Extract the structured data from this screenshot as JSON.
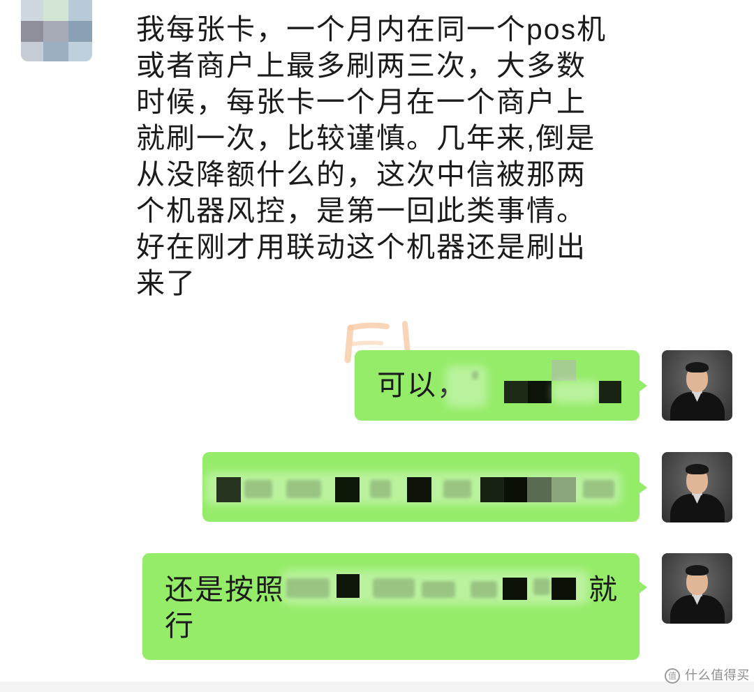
{
  "chat": {
    "incoming": {
      "lines": [
        "我每张卡，一个月内在同一个pos机",
        "或者商户上最多刷两三次，大多数",
        "时候，每张卡一个月在一个商户上",
        "就刷一次，比较谨慎。几年来,倒是",
        "从没降额什么的，这次中信被那两",
        "个机器风控，是第一回此类事情。",
        "好在刚才用联动这个机器还是刷出",
        "来了"
      ]
    },
    "outgoing": [
      {
        "text_start": "可以，"
      },
      {},
      {
        "line1_start": "还是按照",
        "line1_end": "就",
        "line2": "行"
      }
    ]
  },
  "watermark": {
    "logo_text": "值",
    "text": "什么值得买"
  },
  "icons": {
    "contact_avatar": "contact-avatar",
    "sender_avatar": "user-avatar",
    "watermark_logo": "zhide-logo-icon"
  },
  "colors": {
    "outgoing_bubble": "#95ec69",
    "message_text": "#1b1b1b",
    "watermark_text": "#8d8d8d",
    "background": "#ffffff"
  }
}
